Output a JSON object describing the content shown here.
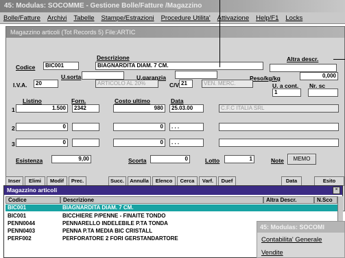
{
  "app": {
    "title": "45: Modulas: SOCOMME - Gestione Bolle/Fatture /Magazzino",
    "menu": [
      "Bolle/Fatture",
      "Archivi",
      "Tabelle",
      "Stampe/Estrazioni",
      "Procedure Utilita'",
      "Attivazione",
      "Help/F1",
      "Locks"
    ]
  },
  "form": {
    "title": "Magazzino articoli (Tot Records 5)                          File:ARTIC",
    "codice": {
      "label": "Codice",
      "value": "BIC001"
    },
    "descrizione": {
      "label": "Descrizione",
      "value": "BIAGNARDITA DIAM. 7 CM."
    },
    "altra_descr": {
      "label": "Altra descr."
    },
    "u_sorta": {
      "label": "U.sorta"
    },
    "u_garanzia": {
      "label": "U.garanzia"
    },
    "peso": {
      "label": "Peso/kg/kg",
      "value": "0,000"
    },
    "iva": {
      "label": "I.V.A.",
      "value": "20",
      "desc": "ARTICOLO AL 20%"
    },
    "cv": {
      "label": "C/V",
      "value": "21",
      "desc": "VEN. MERC."
    },
    "u_cont": {
      "label": "U. a cont.",
      "value": "1"
    },
    "nr_sc": {
      "label": "Nr. sc"
    },
    "rows": {
      "headers": [
        "Listino",
        "Forn.",
        "Costo ultimo",
        "Data"
      ],
      "items": [
        {
          "n": "1",
          "listino": "1.500",
          "forn": "2342",
          "costo": "980",
          "data": "25.03.00",
          "desc": "C.F.C ITALIA SRL"
        },
        {
          "n": "2",
          "listino": "0",
          "forn": "",
          "costo": "0",
          "data": ". . .",
          "desc": ""
        },
        {
          "n": "3",
          "listino": "0",
          "forn": "",
          "costo": "0",
          "data": ". . .",
          "desc": ""
        }
      ]
    },
    "esistenza": {
      "label": "Esistenza",
      "value": "9,00"
    },
    "scorta": {
      "label": "Scorta",
      "value": "0"
    },
    "lotto": {
      "label": "Lotto",
      "value": "1"
    },
    "note": {
      "label": "Note"
    },
    "memo_button": "MEMO",
    "toolbar": [
      "Inser",
      "Elimi",
      "Modif",
      "Prec.",
      "Succ.",
      "Annulla",
      "Elenco",
      "Cerca",
      "Varf.",
      "Duef",
      "Data",
      "Esito"
    ]
  },
  "lookup": {
    "title": "Magazzino articoli",
    "headers": [
      "Codice",
      "Descrizione",
      "Altra Descr.",
      "N.Sco"
    ],
    "rows": [
      {
        "codice": "BIC001",
        "descrizione": "BIAGNARDITA DIAM. 7 CM.",
        "selected": true
      },
      {
        "codice": "BIC001",
        "descrizione": "BICCHIERE P/PENNE - FINAITE TONDO",
        "selected": false
      },
      {
        "codice": "PENN0044",
        "descrizione": "PENNARELLO INDELEBILE P.TA TONDA",
        "selected": false
      },
      {
        "codice": "PENN0403",
        "descrizione": "PENNA P.TA MEDIA BIC CRISTALL",
        "selected": false
      },
      {
        "codice": "PERF002",
        "descrizione": "PERFORATORE 2 FORI GERSTANDARTORE",
        "selected": false
      }
    ]
  },
  "other_window": {
    "title": "45: Modulas: SOCOMI",
    "menu": [
      "Contabilita' Generale",
      "Vendite"
    ]
  }
}
